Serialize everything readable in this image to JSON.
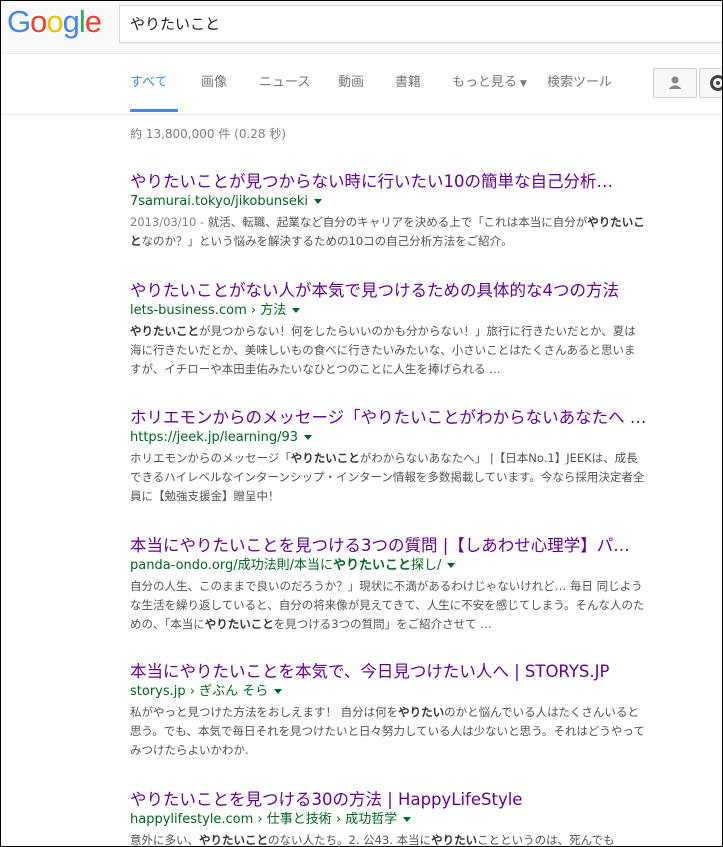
{
  "search": {
    "query": "やりたいこと"
  },
  "logo": {
    "letters": [
      "G",
      "o",
      "o",
      "g",
      "l",
      "e"
    ],
    "colors": [
      "#4285f4",
      "#ea4335",
      "#fbbc05",
      "#4285f4",
      "#34a853",
      "#ea4335"
    ]
  },
  "tabs": [
    {
      "label": "すべて",
      "active": true
    },
    {
      "label": "画像"
    },
    {
      "label": "ニュース"
    },
    {
      "label": "動画"
    },
    {
      "label": "書籍"
    },
    {
      "label": "もっと見る",
      "caret": "▼"
    },
    {
      "label": "検索ツール"
    }
  ],
  "stats": "約 13,800,000 件 (0.28 秒)",
  "icons": {
    "account": "person-icon",
    "settings": "gear-icon"
  },
  "results": [
    {
      "title": "やりたいことが見つからない時に行いたい10の簡単な自己分析…",
      "url": "7samurai.tokyo/jikobunseki",
      "date": "2013/03/10 - ",
      "snippet_parts": [
        {
          "t": "就活、転職、起業など自分のキャリアを決める上で「これは本当に自分が"
        },
        {
          "t": "やりたいこと",
          "b": true
        },
        {
          "t": "なのか？」という悩みを解決するための10コの自己分析方法をご紹介。"
        }
      ]
    },
    {
      "title": "やりたいことがない人が本気で見つけるための具体的な4つの方法",
      "url": "lets-business.com › 方法",
      "snippet_parts": [
        {
          "t": "やりたいこと",
          "b": true
        },
        {
          "t": "が見つからない！何をしたらいいのかも分からない！」旅行に行きたいだとか、夏は海に行きたいだとか、美味しいもの食べに行きたいみたいな、小さいことはたくさんあると思いますが、イチローや本田圭佑みたいなひとつのことに人生を捧げられる …"
        }
      ]
    },
    {
      "title": "ホリエモンからのメッセージ「やりたいことがわからないあなたへ …",
      "url": "https://jeek.jp/learning/93",
      "snippet_parts": [
        {
          "t": "ホリエモンからのメッセージ「"
        },
        {
          "t": "やりたいこと",
          "b": true
        },
        {
          "t": "がわからないあなたへ」 |【日本No.1】JEEKは、成長できるハイレベルなインターンシップ・インターン情報を多数掲載しています。今なら採用決定者全員に【勉強支援金】贈呈中！"
        }
      ]
    },
    {
      "title": "本当にやりたいことを見つける3つの質問 |【しあわせ心理学】パ…",
      "url_parts": [
        {
          "t": "panda-ondo.org/成功法則/本当に"
        },
        {
          "t": "やりたいこと",
          "b": true
        },
        {
          "t": "探し/"
        }
      ],
      "snippet_parts": [
        {
          "t": "自分の人生、このままで良いのだろうか？」現状に不満があるわけじゃないけれど… 毎日 同じような生活を繰り返していると、自分の将来像が見えてきて、人生に不安を感じてしまう。そんな人のための、「本当に"
        },
        {
          "t": "やりたいこと",
          "b": true
        },
        {
          "t": "を見つける3つの質問」をご紹介させて …"
        }
      ]
    },
    {
      "title": "本当にやりたいことを本気で、今日見つけたい人へ | STORYS.JP",
      "url": "storys.jp › ぎぶん そら",
      "snippet_parts": [
        {
          "t": "私がやっと見つけた方法をおしえます！ 自分は何を"
        },
        {
          "t": "やりたい",
          "b": true
        },
        {
          "t": "のかと悩んでいる人はたくさんいると思う。でも、本気で毎日それを見つけたいと日々努力している人は少ないと思う。それはどうやってみつけたらよいかわか."
        }
      ]
    },
    {
      "title": "やりたいことを見つける30の方法 | HappyLifeStyle",
      "url": "happylifestyle.com › 仕事と技術 › 成功哲学",
      "snippet_parts": [
        {
          "t": "意外に多い、"
        },
        {
          "t": "やりたいこと",
          "b": true
        },
        {
          "t": "のない人たち。2. 公43. 本当に"
        },
        {
          "t": "やりたい",
          "b": true
        },
        {
          "t": "ことというのは、死んでも"
        }
      ]
    }
  ]
}
